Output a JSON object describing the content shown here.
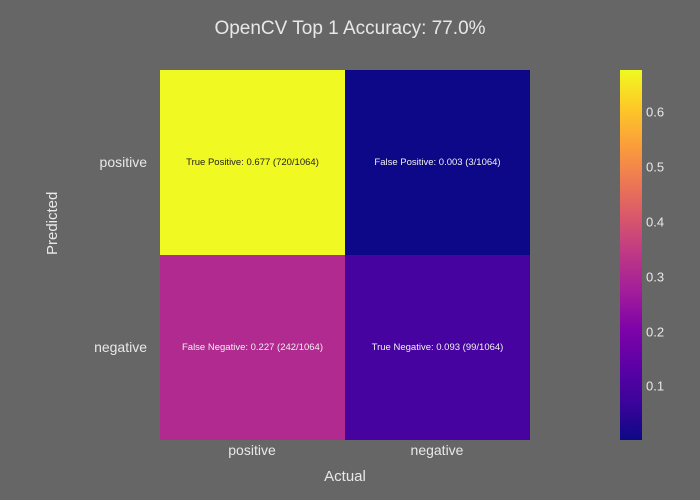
{
  "chart_data": {
    "type": "heatmap",
    "title": "OpenCV Top 1 Accuracy: 77.0%",
    "xlabel": "Actual",
    "ylabel": "Predicted",
    "x_categories": [
      "positive",
      "negative"
    ],
    "y_categories": [
      "positive",
      "negative"
    ],
    "cells": [
      {
        "row": "positive",
        "col": "positive",
        "label": "True Positive: 0.677 (720/1064)",
        "value": 0.677,
        "count": 720,
        "total": 1064,
        "color": "#f0f921",
        "text_color": "dark"
      },
      {
        "row": "positive",
        "col": "negative",
        "label": "False Positive: 0.003 (3/1064)",
        "value": 0.003,
        "count": 3,
        "total": 1064,
        "color": "#0d0887",
        "text_color": "light"
      },
      {
        "row": "negative",
        "col": "positive",
        "label": "False Negative: 0.227 (242/1064)",
        "value": 0.227,
        "count": 242,
        "total": 1064,
        "color": "#b12a90",
        "text_color": "light"
      },
      {
        "row": "negative",
        "col": "negative",
        "label": "True Negative: 0.093 (99/1064)",
        "value": 0.093,
        "count": 99,
        "total": 1064,
        "color": "#46039f",
        "text_color": "light"
      }
    ],
    "colorbar": {
      "min": 0.003,
      "max": 0.677,
      "ticks": [
        0.1,
        0.2,
        0.3,
        0.4,
        0.5,
        0.6
      ]
    },
    "colorscale": "plasma"
  }
}
